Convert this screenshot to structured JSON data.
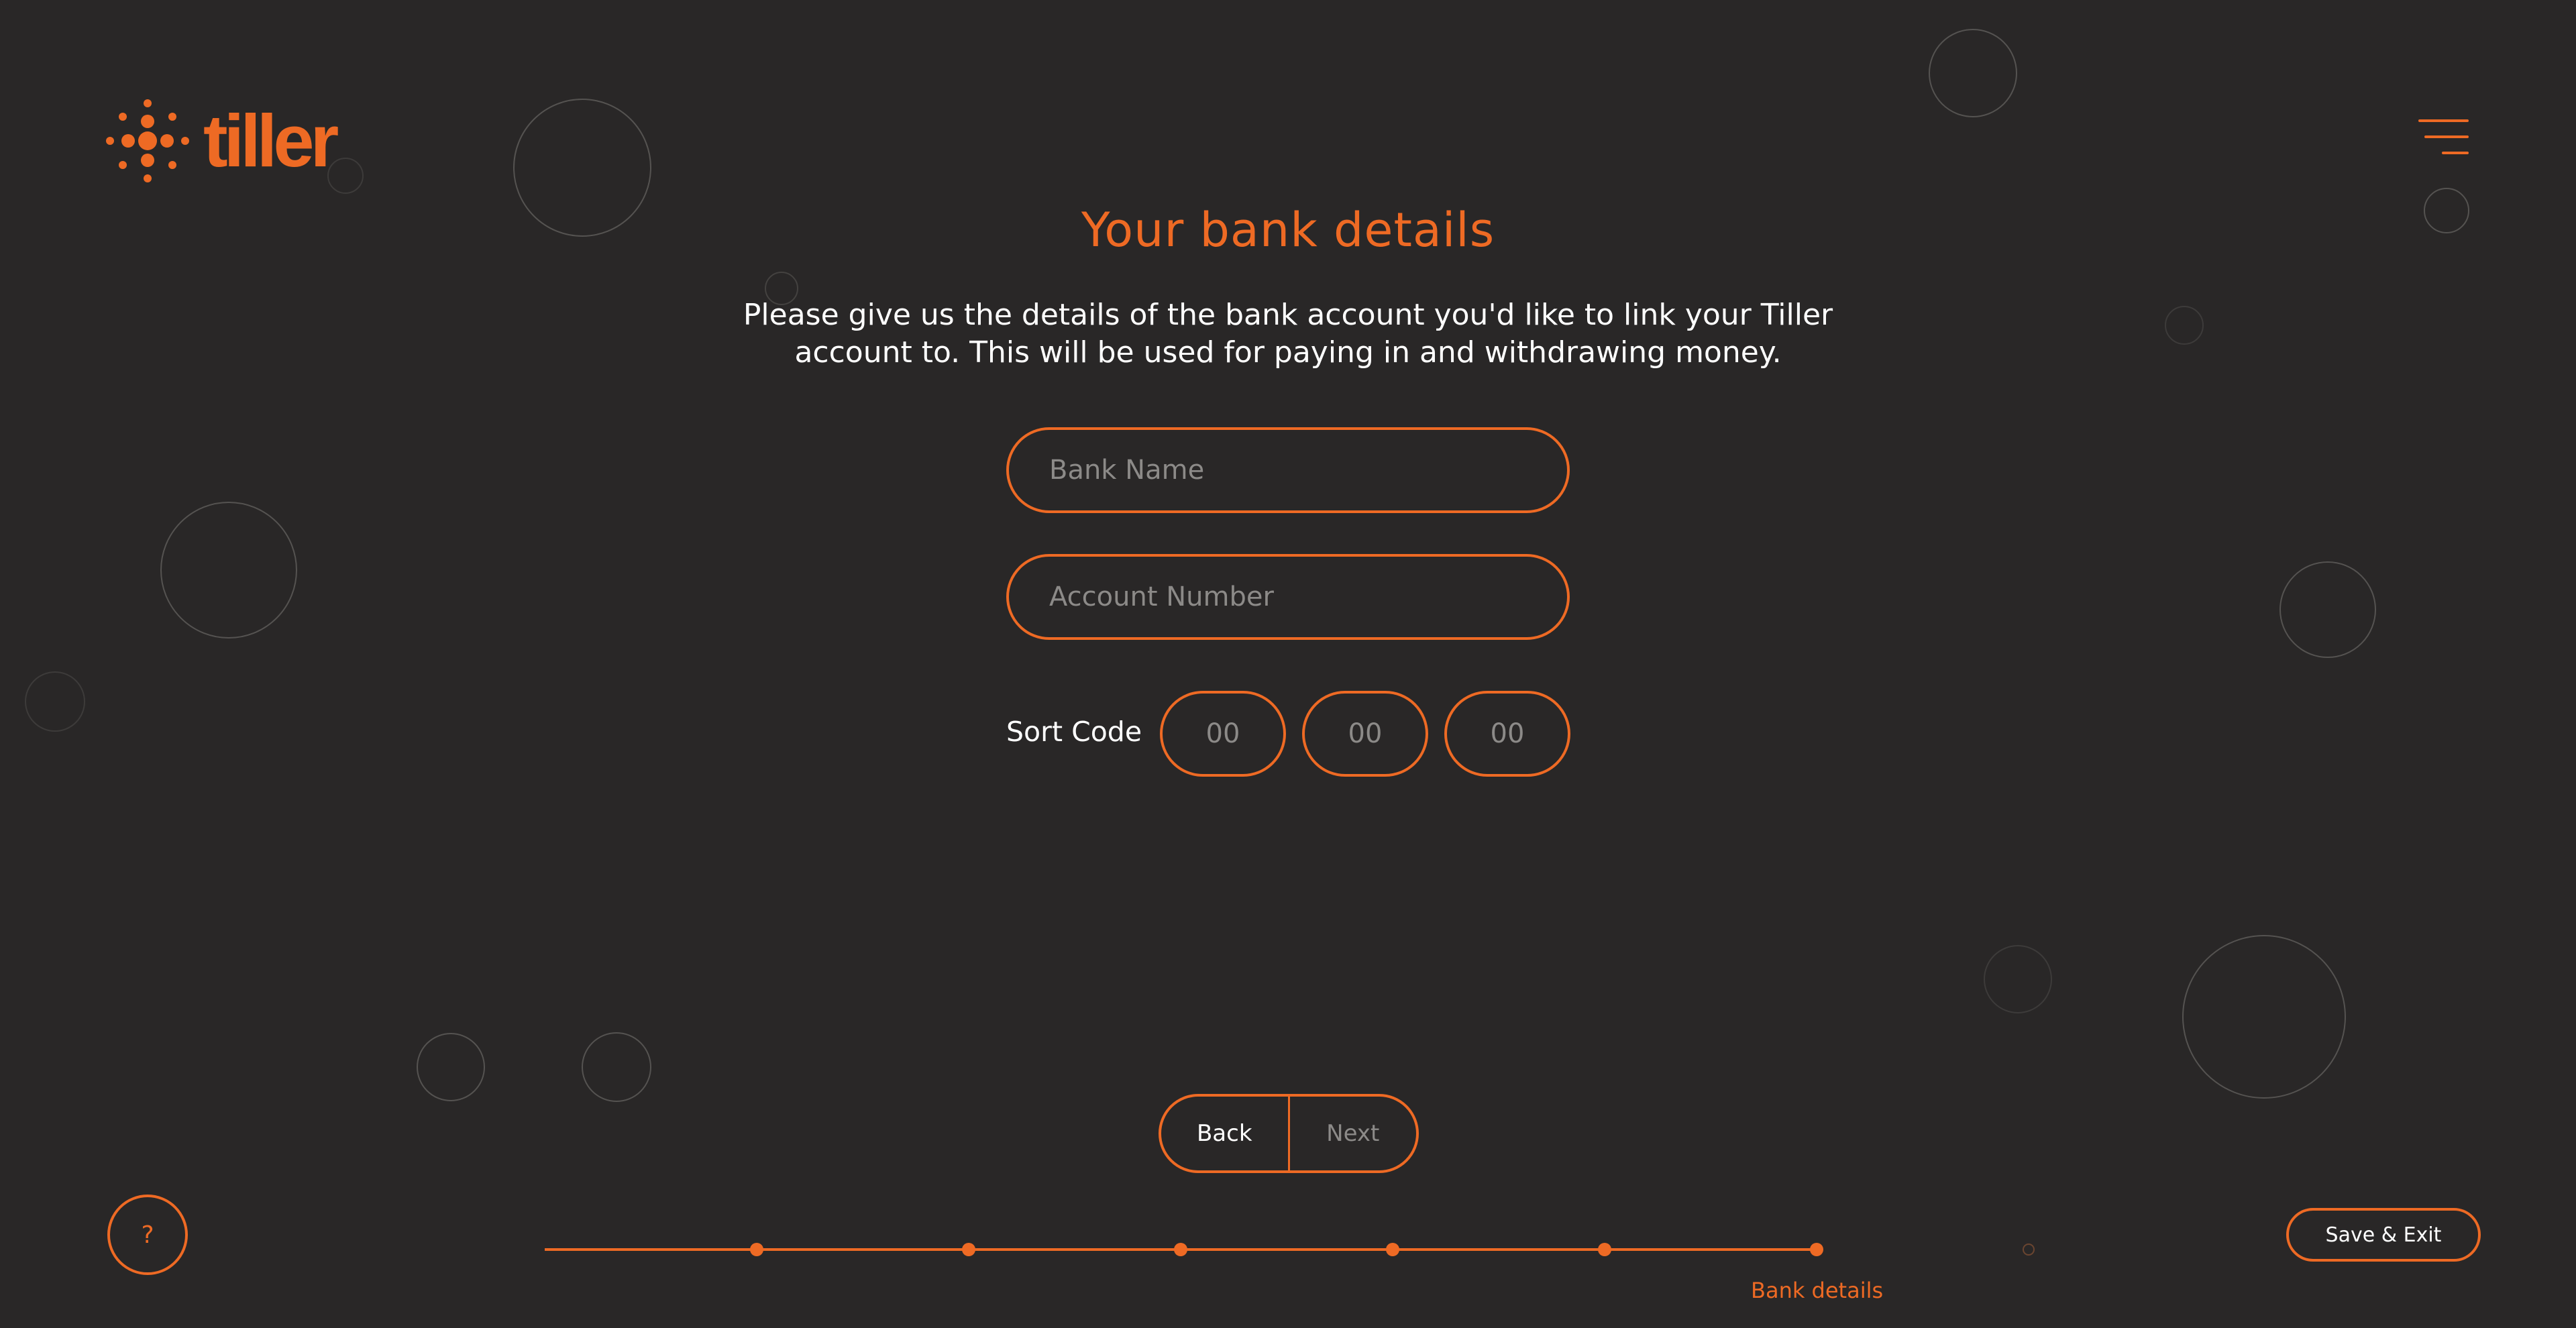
{
  "brand": {
    "name": "tiller",
    "accent_color": "#ee6a24",
    "background_color": "#292727",
    "logo_icon": "sparkle-dots-logo"
  },
  "header": {
    "menu_icon": "hamburger-menu-icon"
  },
  "page": {
    "title": "Your bank details",
    "intro": "Please give us the details of the bank account you'd like to link your Tiller account to. This will be used for paying in and withdrawing money."
  },
  "form": {
    "bank_name": {
      "value": "",
      "placeholder": "Bank Name"
    },
    "account_number": {
      "value": "",
      "placeholder": "Account Number"
    },
    "sort_code": {
      "label": "Sort Code",
      "fields": [
        {
          "value": "",
          "placeholder": "00"
        },
        {
          "value": "",
          "placeholder": "00"
        },
        {
          "value": "",
          "placeholder": "00"
        }
      ]
    }
  },
  "navigation": {
    "back_label": "Back",
    "next_label": "Next"
  },
  "footer": {
    "help_label": "?",
    "save_exit_label": "Save & Exit"
  },
  "progress": {
    "total_steps": 7,
    "current_step": 6,
    "current_step_label": "Bank details"
  }
}
